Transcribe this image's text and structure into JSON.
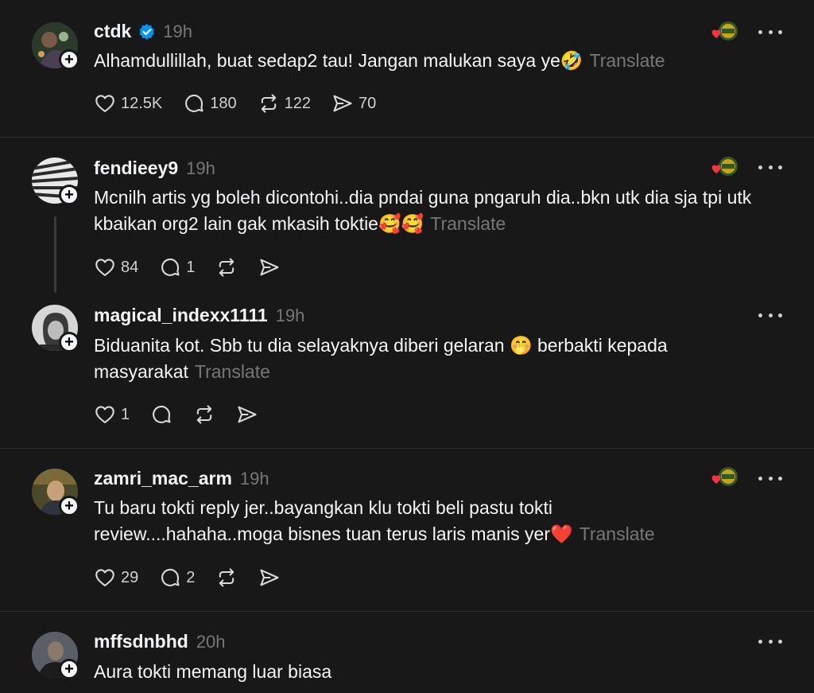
{
  "posts": [
    {
      "username": "ctdk",
      "time": "19h",
      "text": "Alhamdullillah, buat sedap2 tau! Jangan malukan saya ye🤣",
      "translate": "Translate",
      "likes": "12.5K",
      "replies": "180",
      "reposts": "122",
      "shares": "70"
    },
    {
      "username": "fendieey9",
      "time": "19h",
      "text": "Mcnilh artis yg boleh dicontohi..dia pndai guna pngaruh dia..bkn utk dia sja tpi utk kbaikan org2 lain gak mkasih toktie🥰🥰",
      "translate": "Translate",
      "likes": "84",
      "replies": "1"
    },
    {
      "username": "magical_indexx1111",
      "time": "19h",
      "text": "Biduanita kot. Sbb tu dia selayaknya diberi gelaran 🤭 berbakti kepada masyarakat",
      "translate": "Translate",
      "likes": "1"
    },
    {
      "username": "zamri_mac_arm",
      "time": "19h",
      "text": "Tu baru tokti reply jer..bayangkan klu tokti beli pastu tokti review....hahaha..moga bisnes tuan terus laris manis yer❤️",
      "translate": "Translate",
      "likes": "29",
      "replies": "2"
    },
    {
      "username": "mffsdnbhd",
      "time": "20h",
      "text": "Aura tokti memang luar biasa"
    }
  ],
  "icons": {
    "follow": "+",
    "like": "heart-icon",
    "reply": "comment-icon",
    "repost": "repost-icon",
    "share": "send-icon",
    "more": "more-icon",
    "verified": "verified-badge-icon"
  },
  "colors": {
    "background": "#181818",
    "text": "#f3f5f7",
    "muted": "#777777",
    "verified": "#0095f6",
    "liked_heart": "#ff3040"
  }
}
